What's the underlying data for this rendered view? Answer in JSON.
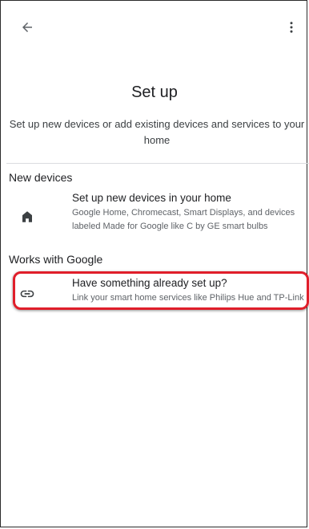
{
  "header": {
    "back_icon": "arrow-back-icon",
    "more_icon": "more-vert-icon"
  },
  "page": {
    "title": "Set up",
    "subtitle": "Set up new devices or add existing devices and services to your home"
  },
  "sections": [
    {
      "header": "New devices",
      "items": [
        {
          "icon": "home-icon",
          "title": "Set up new devices in your home",
          "description": "Google Home, Chromecast, Smart Displays, and devices labeled Made for Google like C by GE smart bulbs"
        }
      ]
    },
    {
      "header": "Works with Google",
      "items": [
        {
          "icon": "link-icon",
          "title": "Have something already set up?",
          "description": "Link your smart home services like Philips Hue and TP-Link"
        }
      ]
    }
  ],
  "colors": {
    "highlight": "#e01e2a",
    "text_primary": "#202124",
    "text_secondary": "#5f6368"
  }
}
